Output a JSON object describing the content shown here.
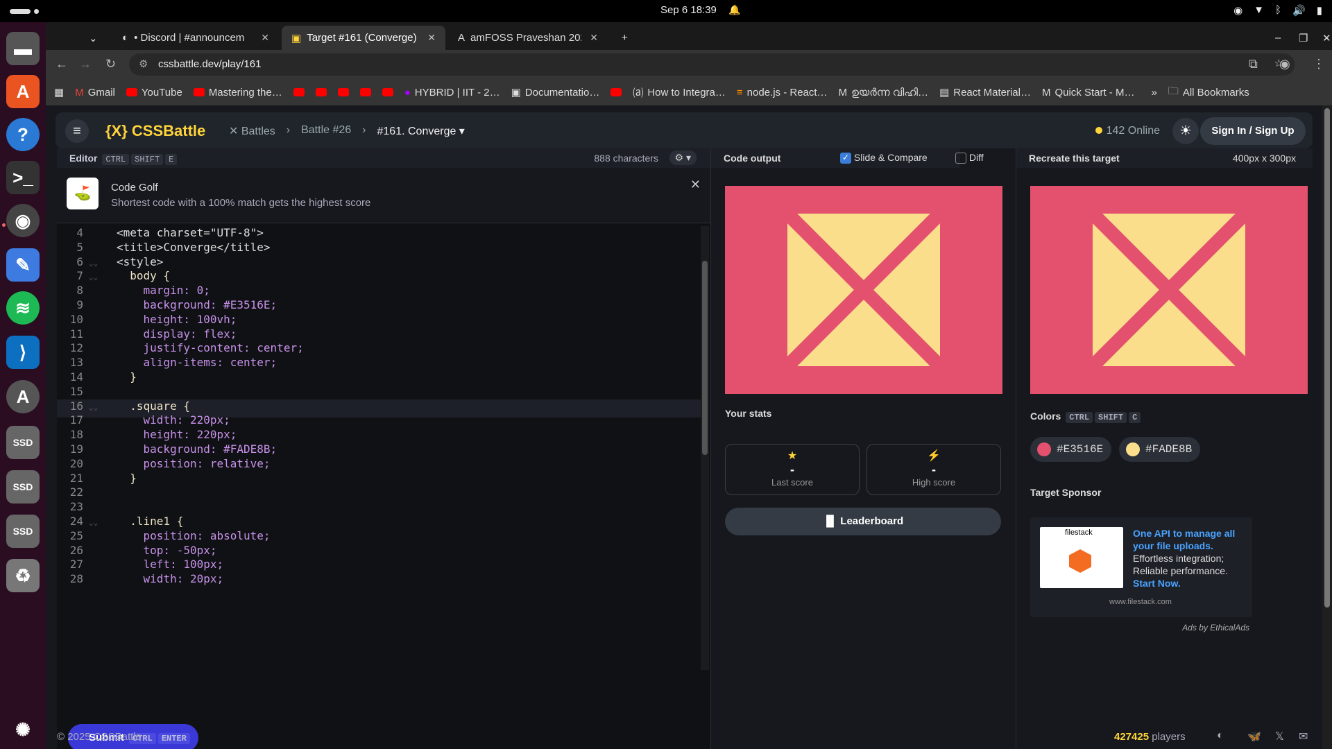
{
  "topbar": {
    "clock": "Sep 6  18:39"
  },
  "tabs": [
    {
      "label": "• Discord | #announceme"
    },
    {
      "label": "Target #161 (Converge) -"
    },
    {
      "label": "amFOSS Praveshan 2025"
    }
  ],
  "url": "cssbattle.dev/play/161",
  "bookmarks": [
    "Gmail",
    "YouTube",
    "Mastering the…",
    "HYBRID | IIT - 2…",
    "Documentatio…",
    "How to Integra…",
    "node.js - React…",
    "ഉയർന്ന വിഹി…",
    "React Material…",
    "Quick Start - M…",
    "All Bookmarks"
  ],
  "header": {
    "logo": "{X} CSSBattle",
    "crumbs": [
      "Battles",
      "Battle #26",
      "#161. Converge"
    ],
    "online": "142 Online",
    "signin": "Sign In / Sign Up"
  },
  "editor": {
    "title": "Editor",
    "shortcut": [
      "CTRL",
      "SHIFT",
      "E"
    ],
    "chars": "888 characters",
    "golf_title": "Code Golf",
    "golf_desc": "Shortest code with a 100% match gets the highest score",
    "lines": [
      {
        "n": "4",
        "t": "<meta charset=\"UTF-8\">"
      },
      {
        "n": "5",
        "t": "<title>Converge</title>"
      },
      {
        "n": "6",
        "t": "<style>"
      },
      {
        "n": "7",
        "t": "  body {"
      },
      {
        "n": "8",
        "t": "    margin: 0;"
      },
      {
        "n": "9",
        "t": "    background: #E3516E;"
      },
      {
        "n": "10",
        "t": "    height: 100vh;"
      },
      {
        "n": "11",
        "t": "    display: flex;"
      },
      {
        "n": "12",
        "t": "    justify-content: center;"
      },
      {
        "n": "13",
        "t": "    align-items: center;"
      },
      {
        "n": "14",
        "t": "  }"
      },
      {
        "n": "15",
        "t": ""
      },
      {
        "n": "16",
        "t": "  .square {"
      },
      {
        "n": "17",
        "t": "    width: 220px;"
      },
      {
        "n": "18",
        "t": "    height: 220px;"
      },
      {
        "n": "19",
        "t": "    background: #FADE8B;"
      },
      {
        "n": "20",
        "t": "    position: relative;"
      },
      {
        "n": "21",
        "t": "  }"
      },
      {
        "n": "22",
        "t": ""
      },
      {
        "n": "23",
        "t": ""
      },
      {
        "n": "24",
        "t": "  .line1 {"
      },
      {
        "n": "25",
        "t": "    position: absolute;"
      },
      {
        "n": "26",
        "t": "    top: -50px;"
      },
      {
        "n": "27",
        "t": "    left: 100px;"
      },
      {
        "n": "28",
        "t": "    width: 20px;"
      }
    ],
    "submit": "Submit",
    "submit_keys": [
      "CTRL",
      "ENTER"
    ]
  },
  "output": {
    "title": "Code output",
    "slide": "Slide & Compare",
    "diff": "Diff",
    "stats_title": "Your stats",
    "last_score_val": "-",
    "last_score": "Last score",
    "high_score_val": "-",
    "high_score": "High score",
    "leaderboard": "Leaderboard"
  },
  "target": {
    "title": "Recreate this target",
    "size": "400px x 300px",
    "colors_title": "Colors",
    "colors_keys": [
      "CTRL",
      "SHIFT",
      "C"
    ],
    "colors": [
      {
        "hex": "#E3516E"
      },
      {
        "hex": "#FADE8B"
      }
    ],
    "sponsor_title": "Target Sponsor",
    "ad_brand": "filestack",
    "ad_head": "One API to manage all your file uploads.",
    "ad_body": "Effortless integration; Reliable performance.",
    "ad_cta": "Start Now.",
    "ad_url": "www.filestack.com",
    "ad_by": "Ads by EthicalAds"
  },
  "footer": {
    "copy": "© 2025 CSSBattle",
    "players_num": "427425",
    "players_label": "players"
  }
}
